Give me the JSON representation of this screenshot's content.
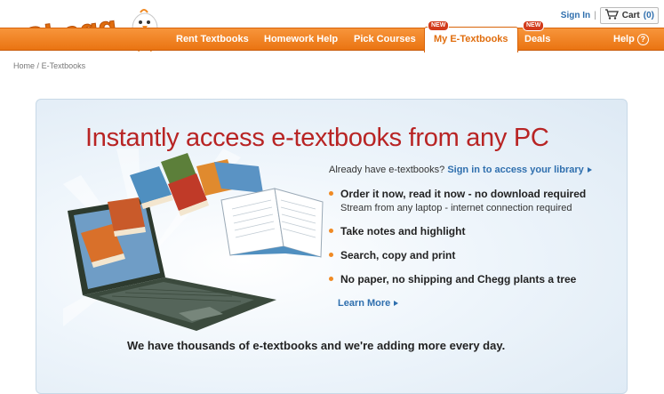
{
  "header": {
    "logo_text": "Chegg",
    "signin_label": "Sign In",
    "separator": "|",
    "cart_label": "Cart",
    "cart_count": "(0)"
  },
  "nav": {
    "items": [
      {
        "label": "Rent Textbooks"
      },
      {
        "label": "Homework Help"
      },
      {
        "label": "Pick Courses"
      }
    ],
    "active_label": "My E-Textbooks",
    "deals_label": "Deals",
    "help_label": "Help",
    "help_symbol": "?",
    "new_badge": "NEW"
  },
  "breadcrumb": {
    "home": "Home",
    "separator": "/",
    "current": "E-Textbooks"
  },
  "main": {
    "headline": "Instantly access e-textbooks from any PC",
    "already_text": "Already have e-textbooks?",
    "library_link": "Sign in to access your library",
    "features": [
      {
        "title": "Order it now, read it now - no download required",
        "sub": "Stream from any laptop - internet connection required"
      },
      {
        "title": "Take notes and highlight"
      },
      {
        "title": "Search, copy and print"
      },
      {
        "title": "No paper, no shipping and Chegg plants a tree"
      }
    ],
    "learn_more": "Learn More",
    "bottom_text": "We have thousands of e-textbooks and we're adding more every day."
  },
  "colors": {
    "brand_orange": "#ef7d1a",
    "headline_red": "#b82424",
    "link_blue": "#2f6fae",
    "bullet_orange": "#f08a24"
  }
}
